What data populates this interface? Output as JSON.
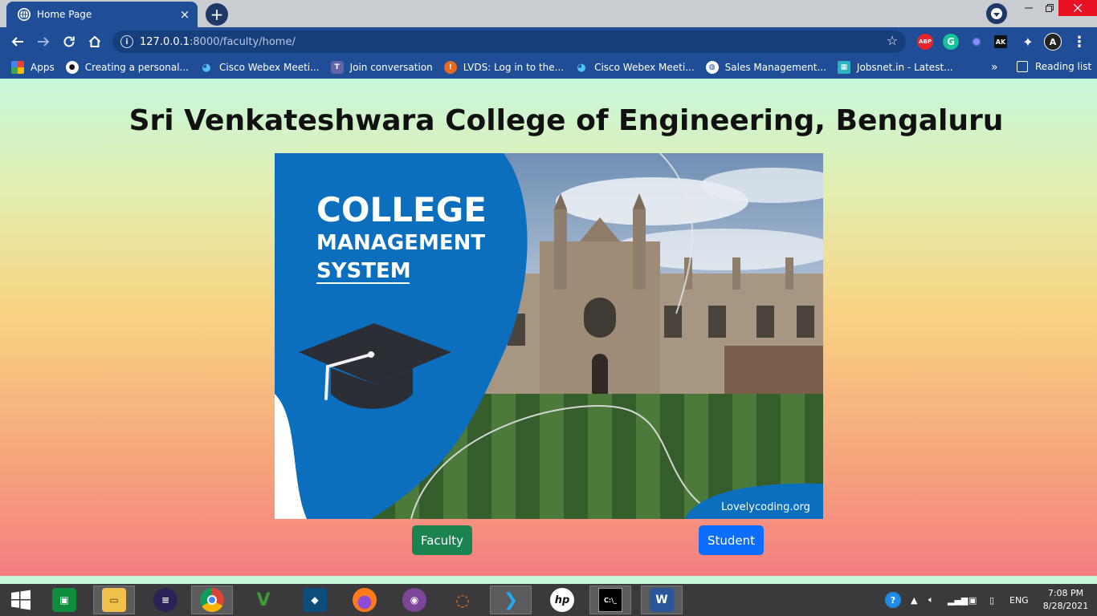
{
  "browser": {
    "tab_title": "Home Page",
    "url_host": "127.0.0.1",
    "url_path": ":8000/faculty/home/",
    "new_tab_symbol": "+",
    "tab_close_symbol": "×"
  },
  "bookmarks": {
    "apps_label": "Apps",
    "items": [
      {
        "label": "Creating a personal...",
        "icon": "github-icon"
      },
      {
        "label": "Cisco Webex Meeti...",
        "icon": "webex-icon"
      },
      {
        "label": "Join conversation",
        "icon": "teams-icon"
      },
      {
        "label": "LVDS: Log in to the...",
        "icon": "lvds-icon"
      },
      {
        "label": "Cisco Webex Meeti...",
        "icon": "webex-icon"
      },
      {
        "label": "Sales Management...",
        "icon": "globe-icon"
      },
      {
        "label": "Jobsnet.in - Latest...",
        "icon": "jobsnet-icon"
      }
    ],
    "more_symbol": "»",
    "reading_list_label": "Reading list"
  },
  "extensions": {
    "abp": "ABP",
    "grammarly": "G",
    "ak": "AK"
  },
  "page": {
    "heading": "Sri Venkateshwara College of Engineering, Bengaluru",
    "hero": {
      "line1": "COLLEGE",
      "line2": "MANAGEMENT",
      "line3": "SYSTEM",
      "watermark": "Lovelycoding.org"
    },
    "faculty_button": "Faculty",
    "student_button": "Student"
  },
  "taskbar": {
    "language": "ENG",
    "time": "7:08 PM",
    "date": "8/28/2021"
  },
  "colors": {
    "chrome_blue": "#1f4e97",
    "faculty_green": "#1a8350",
    "student_blue": "#0d6efd",
    "hero_blue": "#0b6fbd"
  }
}
